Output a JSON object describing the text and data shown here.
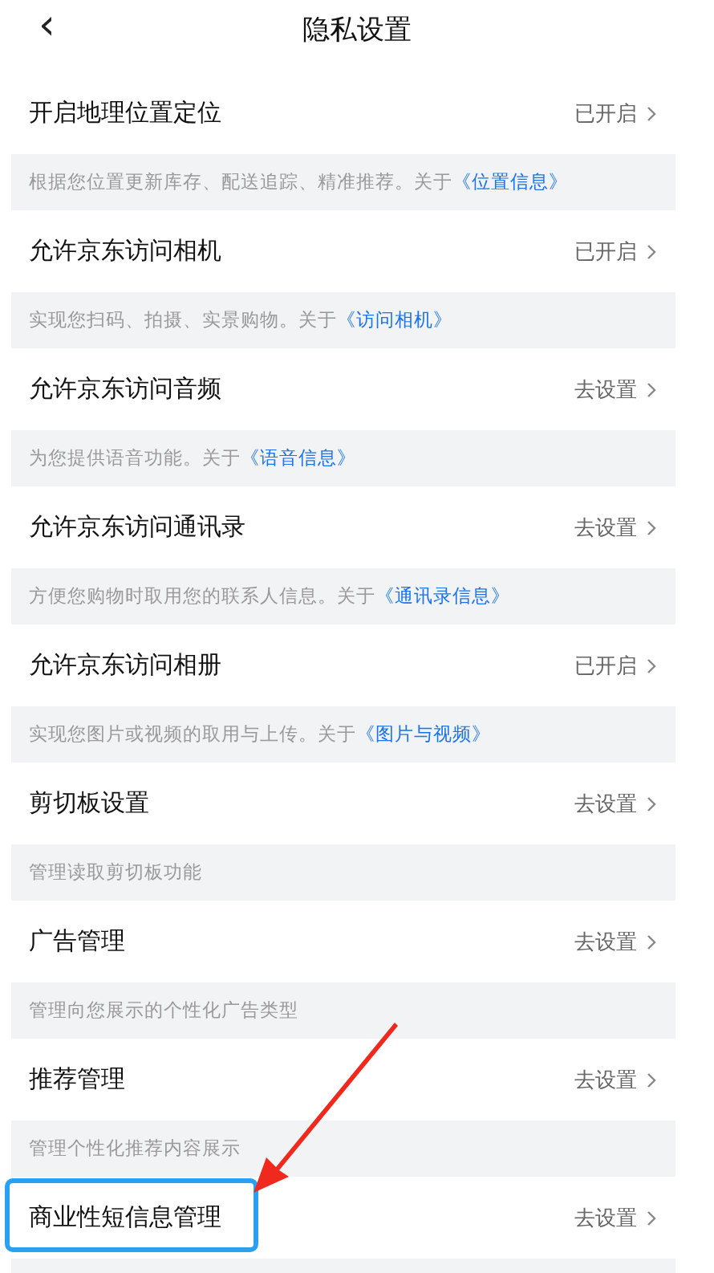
{
  "header": {
    "back": "‹",
    "title": "隐私设置"
  },
  "settings": [
    {
      "label": "开启地理位置定位",
      "value": "已开启",
      "description": "根据您位置更新库存、配送追踪、精准推荐。关于",
      "link": "《位置信息》",
      "highlighted": false
    },
    {
      "label": "允许京东访问相机",
      "value": "已开启",
      "description": "实现您扫码、拍摄、实景购物。关于",
      "link": "《访问相机》",
      "highlighted": false
    },
    {
      "label": "允许京东访问音频",
      "value": "去设置",
      "description": "为您提供语音功能。关于",
      "link": "《语音信息》",
      "highlighted": false
    },
    {
      "label": "允许京东访问通讯录",
      "value": "去设置",
      "description": "方便您购物时取用您的联系人信息。关于",
      "link": "《通讯录信息》",
      "highlighted": false
    },
    {
      "label": "允许京东访问相册",
      "value": "已开启",
      "description": "实现您图片或视频的取用与上传。关于",
      "link": "《图片与视频》",
      "highlighted": false
    },
    {
      "label": "剪切板设置",
      "value": "去设置",
      "description": "管理读取剪切板功能",
      "highlighted": false
    },
    {
      "label": "广告管理",
      "value": "去设置",
      "description": "管理向您展示的个性化广告类型",
      "highlighted": false
    },
    {
      "label": "推荐管理",
      "value": "去设置",
      "description": "管理个性化推荐内容展示",
      "highlighted": false
    },
    {
      "label": "商业性短信息管理",
      "value": "去设置",
      "highlighted": true
    }
  ]
}
